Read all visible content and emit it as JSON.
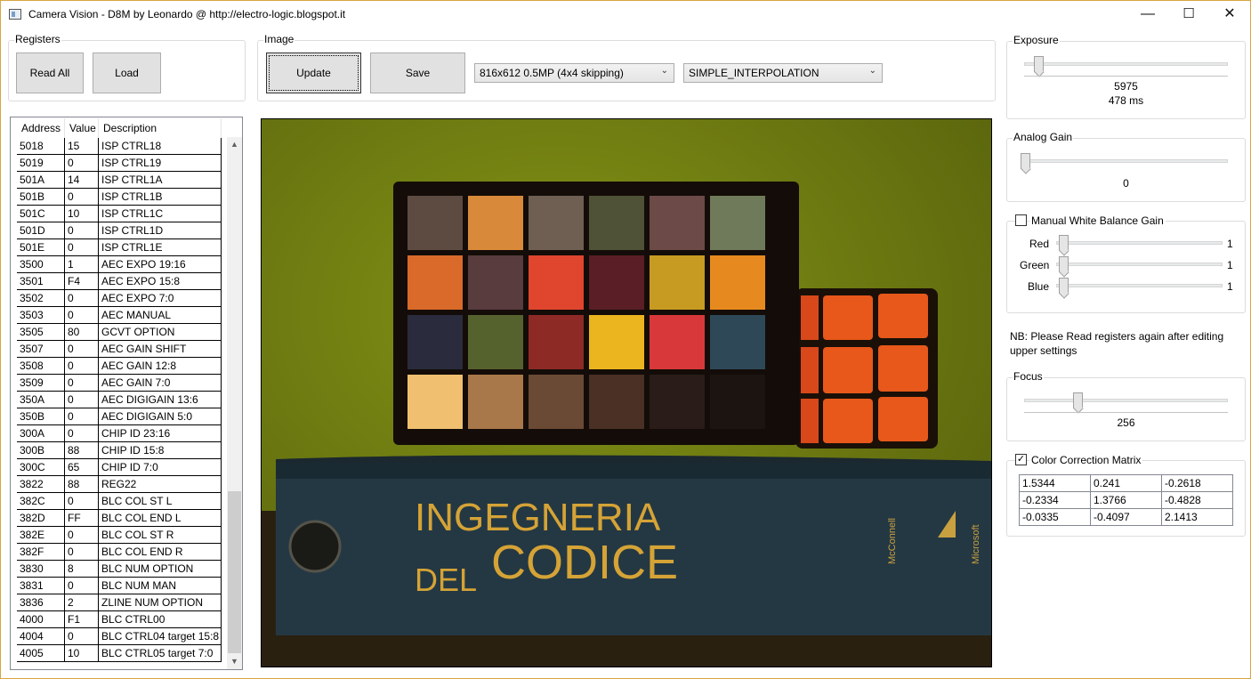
{
  "window": {
    "title": "Camera Vision - D8M by Leonardo @ http://electro-logic.blogspot.it",
    "minimize": "—",
    "maximize": "☐",
    "close": "✕"
  },
  "registers": {
    "label": "Registers",
    "read_all": "Read All",
    "load": "Load",
    "columns": [
      "Address",
      "Value",
      "Description"
    ],
    "rows": [
      [
        "5018",
        "15",
        "ISP CTRL18"
      ],
      [
        "5019",
        "0",
        "ISP CTRL19"
      ],
      [
        "501A",
        "14",
        "ISP CTRL1A"
      ],
      [
        "501B",
        "0",
        "ISP CTRL1B"
      ],
      [
        "501C",
        "10",
        "ISP CTRL1C"
      ],
      [
        "501D",
        "0",
        "ISP CTRL1D"
      ],
      [
        "501E",
        "0",
        "ISP CTRL1E"
      ],
      [
        "3500",
        "1",
        "AEC EXPO 19:16"
      ],
      [
        "3501",
        "F4",
        "AEC EXPO 15:8"
      ],
      [
        "3502",
        "0",
        "AEC EXPO 7:0"
      ],
      [
        "3503",
        "0",
        "AEC MANUAL"
      ],
      [
        "3505",
        "80",
        "GCVT OPTION"
      ],
      [
        "3507",
        "0",
        "AEC GAIN SHIFT"
      ],
      [
        "3508",
        "0",
        "AEC GAIN 12:8"
      ],
      [
        "3509",
        "0",
        "AEC GAIN 7:0"
      ],
      [
        "350A",
        "0",
        "AEC DIGIGAIN 13:6"
      ],
      [
        "350B",
        "0",
        "AEC DIGIGAIN 5:0"
      ],
      [
        "300A",
        "0",
        "CHIP ID 23:16"
      ],
      [
        "300B",
        "88",
        "CHIP ID 15:8"
      ],
      [
        "300C",
        "65",
        "CHIP ID 7:0"
      ],
      [
        "3822",
        "88",
        "REG22"
      ],
      [
        "382C",
        "0",
        "BLC COL ST L"
      ],
      [
        "382D",
        "FF",
        "BLC COL END L"
      ],
      [
        "382E",
        "0",
        "BLC COL ST R"
      ],
      [
        "382F",
        "0",
        "BLC COL END R"
      ],
      [
        "3830",
        "8",
        "BLC NUM OPTION"
      ],
      [
        "3831",
        "0",
        "BLC NUM MAN"
      ],
      [
        "3836",
        "2",
        "ZLINE NUM OPTION"
      ],
      [
        "4000",
        "F1",
        "BLC CTRL00"
      ],
      [
        "4004",
        "0",
        "BLC CTRL04 target 15:8"
      ],
      [
        "4005",
        "10",
        "BLC CTRL05 target 7:0"
      ]
    ]
  },
  "image": {
    "label": "Image",
    "update": "Update",
    "save": "Save",
    "resolution": "816x612 0.5MP (4x4 skipping)",
    "interpolation": "SIMPLE_INTERPOLATION",
    "book_line1": "INGEGNERIA",
    "book_line2a": "DEL",
    "book_line2b": "CODICE",
    "spine_publisher": "McConnell",
    "spine_brand": "Microsoft",
    "checker_colors": [
      "#5d4a41",
      "#d9893a",
      "#6e5f52",
      "#4f5236",
      "#6b4a48",
      "#6f7a5a",
      "#d96a2a",
      "#593c3e",
      "#e0452e",
      "#5a1e26",
      "#c79a22",
      "#e68a1f",
      "#2a2c3e",
      "#56622e",
      "#8e2a26",
      "#ebb520",
      "#d8383a",
      "#2e4858",
      "#f0c070",
      "#a8784a",
      "#6a4a35",
      "#4a3025",
      "#2a1c18",
      "#1c1410"
    ],
    "bg_color": "#6d7a12"
  },
  "exposure": {
    "label": "Exposure",
    "value": "5975",
    "time": "478 ms",
    "level": 0.05
  },
  "analog_gain": {
    "label": "Analog Gain",
    "value": "0",
    "level": 0
  },
  "white_balance": {
    "label": "Manual White Balance Gain",
    "checked": false,
    "red_label": "Red",
    "red_value": "1",
    "green_label": "Green",
    "green_value": "1",
    "blue_label": "Blue",
    "blue_value": "1"
  },
  "note": "NB: Please Read registers again after editing upper settings",
  "focus": {
    "label": "Focus",
    "value": "256",
    "level": 0.25
  },
  "color_correction": {
    "label": "Color Correction Matrix",
    "checked": true,
    "checkmark": "✓",
    "matrix": [
      [
        "1.5344",
        "0.241",
        "-0.2618"
      ],
      [
        "-0.2334",
        "1.3766",
        "-0.4828"
      ],
      [
        "-0.0335",
        "-0.4097",
        "2.1413"
      ]
    ]
  }
}
